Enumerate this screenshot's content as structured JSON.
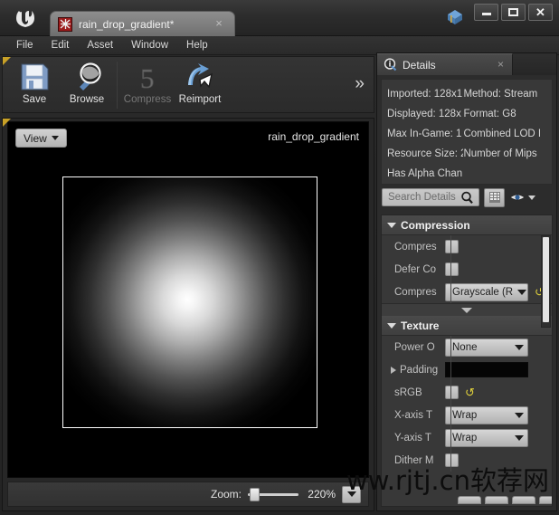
{
  "window": {
    "app_icon": "unreal-logo-icon",
    "document_tab": {
      "title": "rain_drop_gradient*",
      "icon": "texture-asset-icon",
      "close": "×"
    },
    "controls": {
      "minimize": "minimize-icon",
      "maximize": "maximize-icon",
      "close": "✕"
    }
  },
  "menubar": {
    "items": [
      "File",
      "Edit",
      "Asset",
      "Window",
      "Help"
    ]
  },
  "toolbar": {
    "buttons": [
      {
        "label": "Save",
        "icon": "save-floppy-icon",
        "enabled": true
      },
      {
        "label": "Browse",
        "icon": "magnifier-browse-icon",
        "enabled": true
      },
      {
        "label": "Compress",
        "icon": "compress-icon",
        "enabled": false
      },
      {
        "label": "Reimport",
        "icon": "reimport-arrow-icon",
        "enabled": true
      }
    ],
    "overflow": "»"
  },
  "viewport": {
    "view_button": "View",
    "asset_name": "rain_drop_gradient",
    "texture": {
      "description": "radial white-to-black gradient"
    },
    "status": {
      "zoom_label": "Zoom:",
      "zoom_value": "220%",
      "zoom_slider_percent": 8
    }
  },
  "details": {
    "tab_label": "Details",
    "tab_icon": "details-info-icon",
    "tab_close": "×",
    "info_rows": [
      {
        "left": "Imported: 128x1",
        "right": "Method: Stream"
      },
      {
        "left": "Displayed: 128x",
        "right": "Format: G8"
      },
      {
        "left": "Max In-Game: 1",
        "right": "Combined LOD I"
      },
      {
        "left": "Resource Size: 2",
        "right": "Number of Mips"
      },
      {
        "left": "Has Alpha Chan",
        "right": ""
      }
    ],
    "search": {
      "placeholder": "Search Details",
      "icon": "search-icon",
      "grid_button": "grid-view-icon",
      "eye_button": "eye-visibility-icon",
      "eye_caret": "chevron-down-icon"
    },
    "sections": [
      {
        "title": "Compression",
        "rows": [
          {
            "name": "Compres",
            "type": "checkbox",
            "value": false
          },
          {
            "name": "Defer Co",
            "type": "checkbox",
            "value": false
          },
          {
            "name": "Compres",
            "type": "combo",
            "value": "Grayscale (R",
            "reset": "↺"
          }
        ]
      },
      {
        "title": "Texture",
        "rows": [
          {
            "name": "Power O",
            "type": "combo",
            "value": "None"
          },
          {
            "name": "Padding",
            "type": "color",
            "value": "#000000",
            "expandable": true
          },
          {
            "name": "sRGB",
            "type": "checkbox",
            "value": false,
            "reset": "↺"
          },
          {
            "name": "X-axis T",
            "type": "combo",
            "value": "Wrap"
          },
          {
            "name": "Y-axis T",
            "type": "combo",
            "value": "Wrap"
          },
          {
            "name": "Dither M",
            "type": "checkbox",
            "value": false
          }
        ]
      }
    ],
    "collapse_caret": "chevron-down-icon"
  },
  "watermark": {
    "text": "ww.rjtj.cn软荐网"
  }
}
